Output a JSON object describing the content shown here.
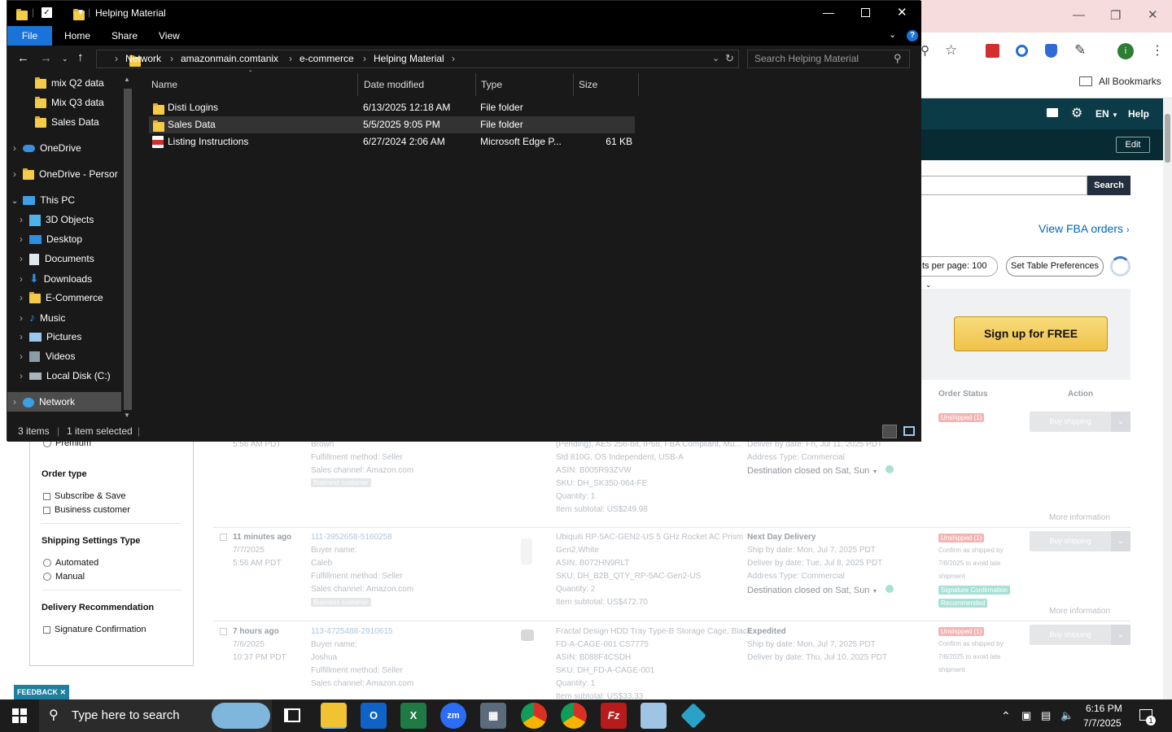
{
  "explorer": {
    "title": "Helping Material",
    "ribbon_tabs": [
      "File",
      "Home",
      "Share",
      "View"
    ],
    "breadcrumb": [
      "Network",
      "amazonmain.comtanix",
      "e-commerce",
      "Helping Material"
    ],
    "search_placeholder": "Search Helping Material",
    "nav_items": [
      {
        "label": "mix Q2 data",
        "icon": "folder-icon"
      },
      {
        "label": "Mix Q3 data",
        "icon": "folder-icon"
      },
      {
        "label": "Sales Data",
        "icon": "folder-icon"
      },
      {
        "label": "OneDrive",
        "icon": "onedrive-icon"
      },
      {
        "label": "OneDrive - Persor",
        "icon": "folder-icon"
      },
      {
        "label": "This PC",
        "icon": "pc-icon"
      },
      {
        "label": "3D Objects",
        "icon": "3d-objects-icon"
      },
      {
        "label": "Desktop",
        "icon": "desktop-icon"
      },
      {
        "label": "Documents",
        "icon": "documents-icon"
      },
      {
        "label": "Downloads",
        "icon": "downloads-icon"
      },
      {
        "label": "E-Commerce",
        "icon": "folder-icon"
      },
      {
        "label": "Music",
        "icon": "music-icon"
      },
      {
        "label": "Pictures",
        "icon": "pictures-icon"
      },
      {
        "label": "Videos",
        "icon": "videos-icon"
      },
      {
        "label": "Local Disk (C:)",
        "icon": "disk-icon"
      },
      {
        "label": "Network",
        "icon": "network-icon"
      }
    ],
    "columns": [
      "Name",
      "Date modified",
      "Type",
      "Size"
    ],
    "files": [
      {
        "name": "Disti Logins",
        "date": "6/13/2025 12:18 AM",
        "type": "File folder",
        "size": ""
      },
      {
        "name": "Sales Data",
        "date": "5/5/2025 9:05 PM",
        "type": "File folder",
        "size": ""
      },
      {
        "name": "Listing Instructions",
        "date": "6/27/2024 2:06 AM",
        "type": "Microsoft Edge P...",
        "size": "61 KB"
      }
    ],
    "status_items": "3 items",
    "status_selected": "1 item selected"
  },
  "browser": {
    "all_bookmarks": "All Bookmarks",
    "profile_initial": "i",
    "header_lang": "EN",
    "header_help": "Help",
    "edit_label": "Edit",
    "search_label": "Search",
    "view_fba": "View FBA orders",
    "per_page": "ts per page: 100",
    "table_prefs": "Set Table Preferences",
    "signup": "Sign up for FREE",
    "col_order_status": "Order Status",
    "col_action": "Action"
  },
  "filters": {
    "premium": "Premium",
    "order_type_title": "Order type",
    "order_type_opts": [
      "Subscribe & Save",
      "Business customer"
    ],
    "shipping_title": "Shipping Settings Type",
    "shipping_opts": [
      "Automated",
      "Manual"
    ],
    "delivery_title": "Delivery Recommendation",
    "delivery_opts": [
      "Signature Confirmation"
    ],
    "feedback": "FEEDBACK"
  },
  "orders": [
    {
      "time": "5:56 AM PDT",
      "buyer": "Brown",
      "fulfillment": "Fulfillment method: Seller",
      "channel": "Sales channel: Amazon.com",
      "business": "Business customer",
      "product": "(Pending), AES 256-bit, IP68, FBA Compliant, Mu...",
      "product2": "Std 810G, OS Independent, USB-A",
      "asin": "ASIN: B005R93ZVW",
      "sku": "SKU: DH_SK350-064-FE",
      "qty": "Quantity: 1",
      "subtotal": "Item subtotal: US$249.98",
      "service": "",
      "shipby": "",
      "deliverby": "Deliver by date: Fri, Jul 11, 2025 PDT",
      "address": "Address Type: Commercial",
      "dest": "Destination closed on Sat, Sun",
      "status": "Unshipped (1)",
      "more": "More information"
    },
    {
      "time": "11 minutes ago",
      "date": "7/7/2025",
      "clock": "5:56 AM PDT",
      "order_id": "111-3952658-5160258",
      "buyer_label": "Buyer name:",
      "buyer": "Caleb",
      "fulfillment": "Fulfillment method: Seller",
      "channel": "Sales channel: Amazon.com",
      "business": "Business customer",
      "product": "Ubiquiti RP-5AC-GEN2-US 5 GHz Rocket AC Prism",
      "product2": "Gen2,White",
      "asin": "ASIN: B072HN9RLT",
      "sku": "SKU: DH_B2B_QTY_RP-5AC-Gen2-US",
      "qty": "Quantity: 2",
      "subtotal": "Item subtotal: US$472.70",
      "service": "Next Day Delivery",
      "shipby": "Ship by date: Mon, Jul 7, 2025 PDT",
      "deliverby": "Deliver by date: Tue, Jul 8, 2025 PDT",
      "address": "Address Type: Commercial",
      "dest": "Destination closed on Sat, Sun",
      "status": "Unshipped (1)",
      "confirm": "Confirm as shipped by",
      "confirm_date": "7/8/2025 to avoid late",
      "confirm_tail": "shipment",
      "sig1": "Signature Confirmation",
      "sig2": "Recommended",
      "more": "More information"
    },
    {
      "time": "7 hours ago",
      "date": "7/6/2025",
      "clock": "10:37 PM PDT",
      "order_id": "113-4725488-2910615",
      "buyer_label": "Buyer name:",
      "buyer": "Joshua",
      "fulfillment": "Fulfillment method: Seller",
      "channel": "Sales channel: Amazon.com",
      "product": "Fractal Design HDD Tray Type-B Storage Cage, Black",
      "asin": "FD-A-CAGE-001 CS7775",
      "asin2": "ASIN: B088F4CSDH",
      "sku": "SKU: DH_FD-A-CAGE-001",
      "qty": "Quantity: 1",
      "subtotal": "Item subtotal: US$33.33",
      "service": "Expedited",
      "shipby": "Ship by date: Mon, Jul 7, 2025 PDT",
      "deliverby": "Deliver by date: Thu, Jul 10, 2025 PDT",
      "status": "Unshipped (1)",
      "confirm": "Confirm as shipped by",
      "confirm_date": "7/8/2025 to avoid late",
      "confirm_tail": "shipment"
    }
  ],
  "ship_button": "Buy shipping",
  "taskbar": {
    "search_placeholder": "Type here to search",
    "time": "6:16 PM",
    "date": "7/7/2025",
    "notification_count": "1",
    "apps": [
      "file-explorer",
      "outlook",
      "excel",
      "zoom",
      "calculator",
      "chrome",
      "chrome",
      "filezilla",
      "notes",
      "app"
    ]
  }
}
